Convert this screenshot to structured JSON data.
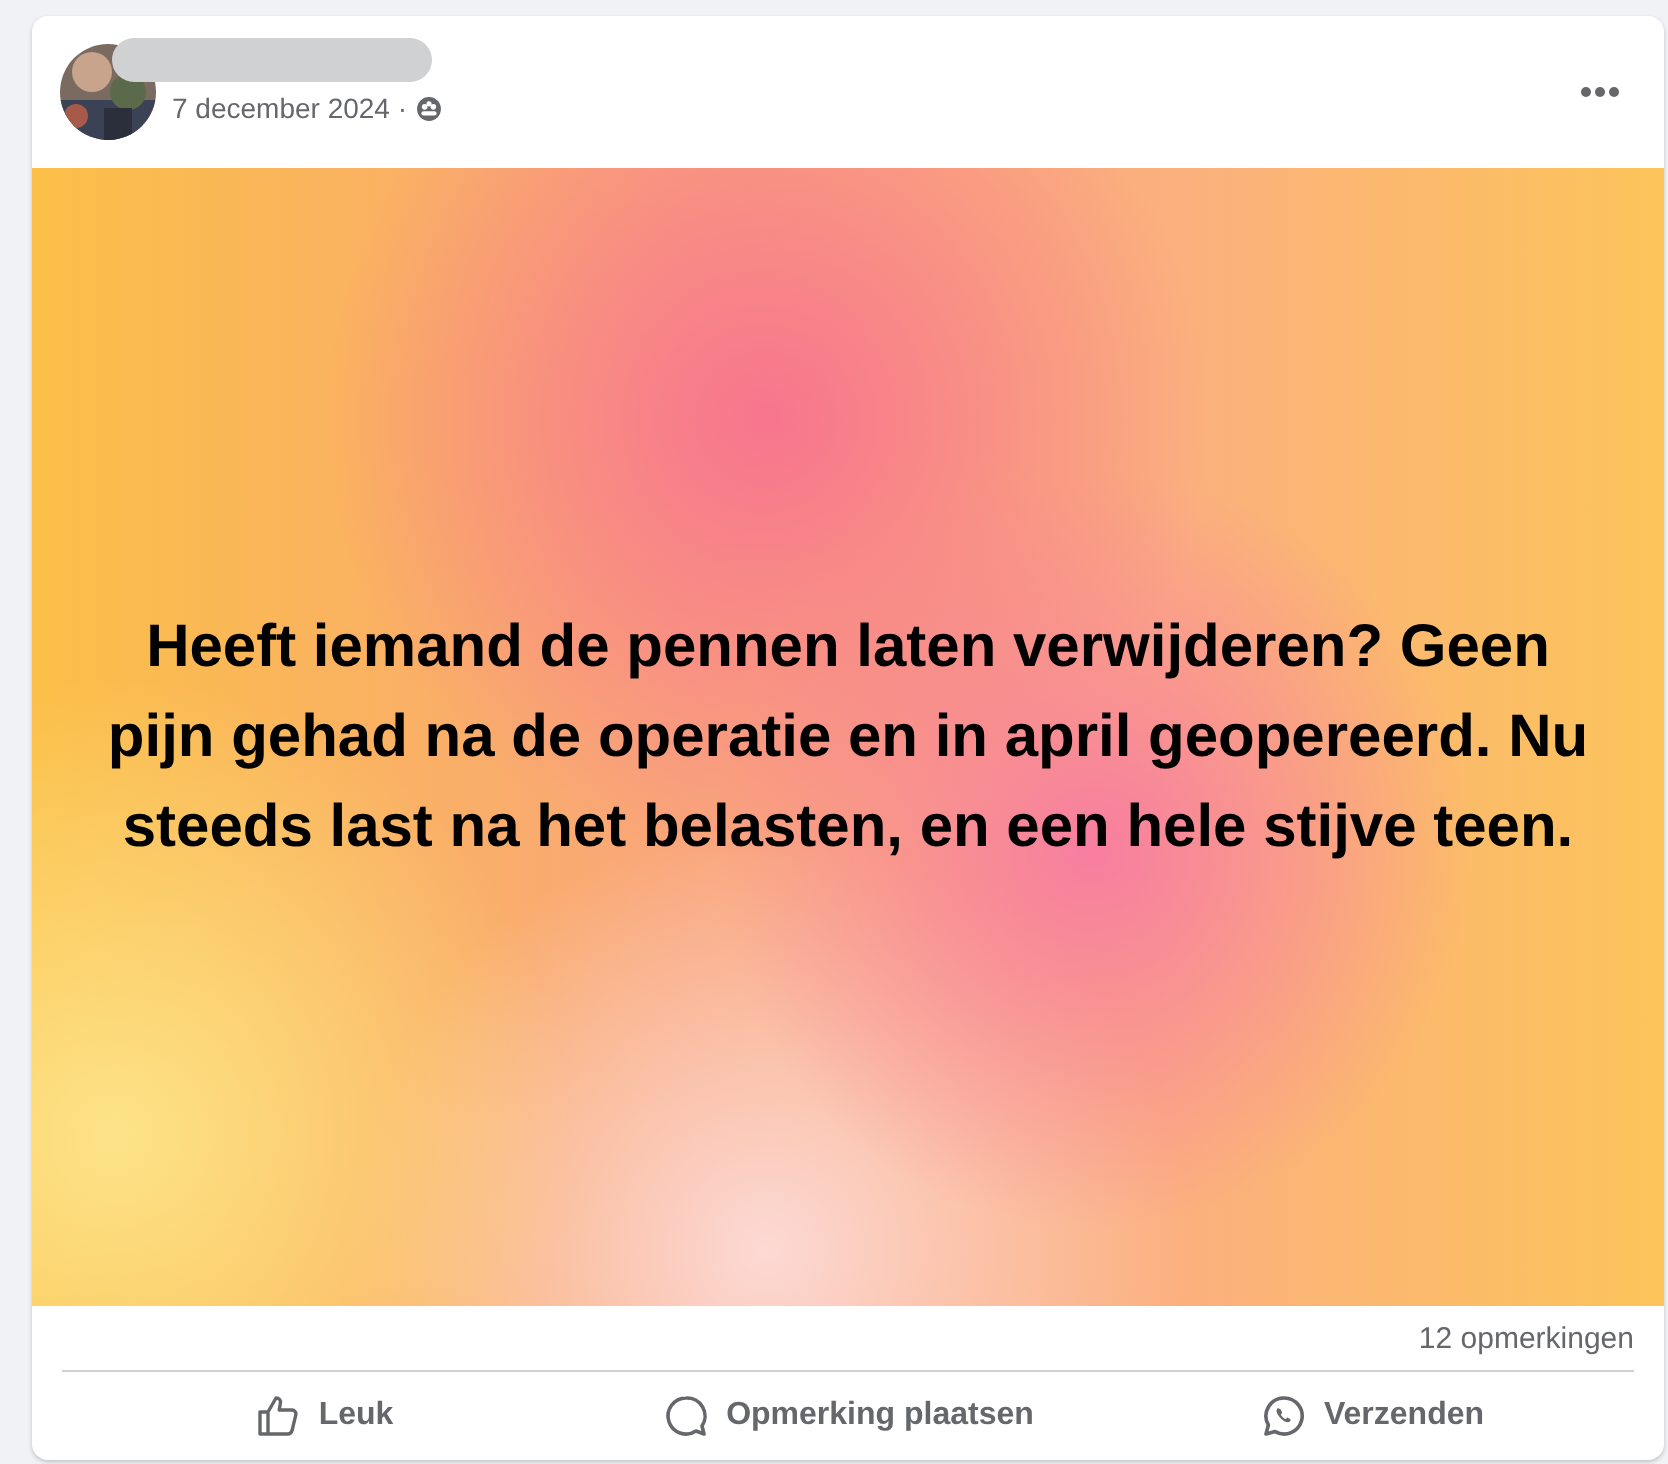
{
  "post": {
    "date": "7 december 2024 ·",
    "text": "Heeft iemand de pennen laten verwijderen? Geen pijn gehad na de operatie en in april geopereerd. Nu steeds last na het belasten, en een hele stijve teen.",
    "comment_count": "12 opmerkingen"
  },
  "actions": [
    {
      "kind": "like",
      "label": "Leuk"
    },
    {
      "kind": "comment",
      "label": "Opmerking plaatsen"
    },
    {
      "kind": "share",
      "label": "Verzenden"
    }
  ]
}
